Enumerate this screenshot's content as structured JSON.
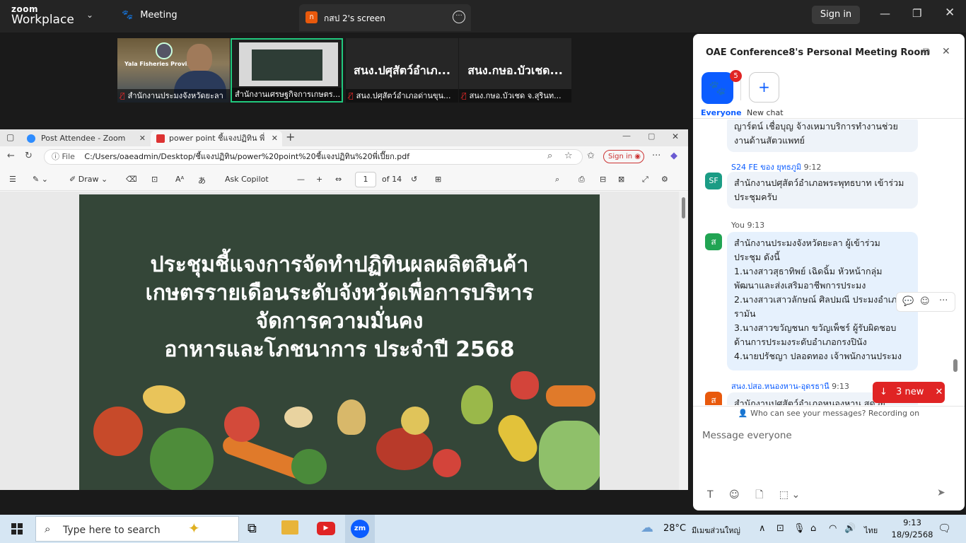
{
  "zoom_top": {
    "logo_line1": "zoom",
    "logo_line2": "Workplace",
    "meeting_tab": "Meeting",
    "share_tab_initial": "ก",
    "share_tab_label": "กสป 2's screen",
    "signin": "Sign in"
  },
  "video_tiles": [
    {
      "name": "สำนักงานประมงจังหวัดยะลา",
      "muted": true
    },
    {
      "name": "สำนักงานเศรษฐกิจการเกษตร...",
      "muted": false,
      "active": true
    },
    {
      "big": "สนง.ปศุสัตว์อำเภ...",
      "name": "สนง.ปศุสัตว์อำเภอด่านขุน...",
      "muted": true
    },
    {
      "big": "สนง.กษอ.บัวเชด...",
      "name": "สนง.กษอ.บัวเชด จ.สุรินท...",
      "muted": true
    }
  ],
  "cam1_overlay_text": "Yala Fisheries Provincial",
  "browser": {
    "tab1": "Post Attendee - Zoom",
    "tab2": "power point ชี้แจงปฏิทิน พี่เปี๊ยก.pdf",
    "address_prefix": "File",
    "address": "C:/Users/oaeadmin/Desktop/ชี้แจงปฏิทิน/power%20point%20ชี้แจงปฏิทิน%20พี่เปี๊ยก.pdf",
    "signin": "Sign in",
    "draw_label": "Draw",
    "ask_copilot": "Ask Copilot",
    "page_current": "1",
    "page_total": "of 14"
  },
  "slide": {
    "line1": "ประชุมชี้แจงการจัดทำปฏิทินผลผลิตสินค้า",
    "line2": "เกษตรรายเดือนระดับจังหวัดเพื่อการบริหาร",
    "line3": "จัดการความมั่นคง",
    "line4": "อาหารและโภชนาการ ประจำปี 2568"
  },
  "chat": {
    "title": "OAE Conference8's Personal Meeting Room",
    "everyone_badge": "5",
    "everyone_label": "Everyone",
    "new_chat_label": "New chat",
    "messages": [
      {
        "text": "ญาร์ตน์ เชื่อบุญ จ้างเหมาบริการทำงานช่วยงานด้านสัตวแพทย์"
      },
      {
        "sender": "S24 FE ของ ยุทธภูมิ",
        "time": "9:12",
        "avatar": "SF",
        "text": "สำนักงานปศุสัตว์อำเภอพระพุทธบาท เข้าร่วมประชุมครับ"
      },
      {
        "sender": "You",
        "time": "9:13",
        "avatar": "ส",
        "lines": [
          "สำนักงานประมงจังหวัดยะลา  ผู้เข้าร่วม",
          "ประชุม ดังนี้",
          "1.นางสาวสุธาทิพย์ เฉิดฉิ้ม  หัวหน้ากลุ่ม",
          "พัฒนาและส่งเสริมอาชีพการประมง",
          "2.นางสาวเสาวลักษณ์ ศิลปมณี ประมงอำเภอ",
          "รามัน",
          "3.นางสาวขวัญชนก ขวัญเพ็ชร์  ผู้รับผิดชอบ",
          "ด้านการประมงระดับอำเภอกรงปินัง",
          "4.นายปรัชญา ปลอดทอง เจ้าพนักงานประมง"
        ]
      },
      {
        "sender": "สนง.ปสอ.หนองหาน-อุดรธานี",
        "time": "9:13",
        "avatar": "ส",
        "text": "สำนักงานปศุสัตว์อำเภอหนองหาน สุดวย"
      }
    ],
    "new_pill": "3 new",
    "notice": "Who can see your messages? Recording on",
    "input_placeholder": "Message everyone"
  },
  "taskbar": {
    "search_placeholder": "Type here to search",
    "zoom_label": "zm",
    "weather": "28°C",
    "weather_desc": "มีเมฆส่วนใหญ่",
    "lang": "ไทย",
    "time": "9:13",
    "date": "18/9/2568"
  }
}
